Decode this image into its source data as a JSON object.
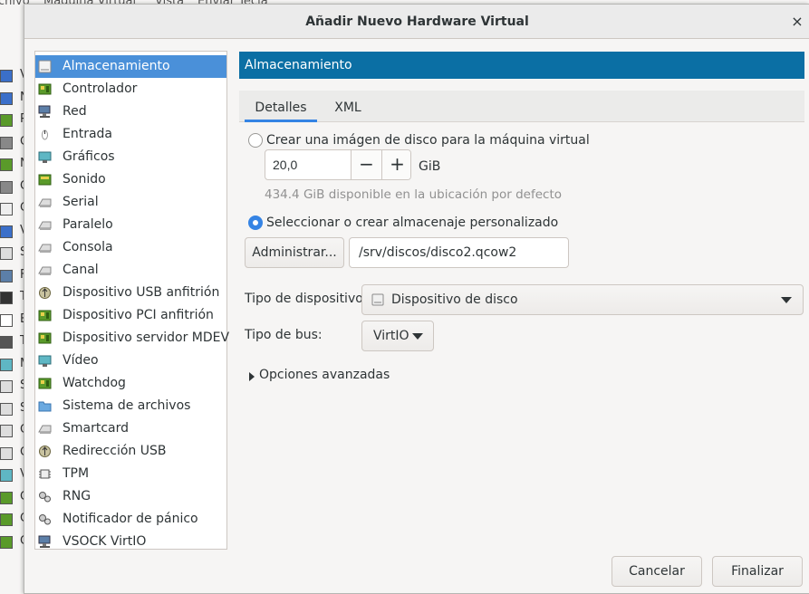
{
  "background": {
    "menu": [
      "chivo",
      "Máquina Virtual",
      "Vista",
      "Enviar Tecla"
    ],
    "side_letters": [
      "V",
      "N",
      "P",
      "C",
      "N",
      "C",
      "C",
      "V",
      "S",
      "F",
      "T",
      "E",
      "T",
      "M",
      "S",
      "S",
      "C",
      "C",
      "V",
      "C",
      "C",
      "C"
    ]
  },
  "dialog": {
    "title": "Añadir Nuevo Hardware Virtual",
    "close_glyph": "×"
  },
  "hardware_list": {
    "selected_index": 0,
    "items": [
      {
        "label": "Almacenamiento",
        "icon": "disk-icon"
      },
      {
        "label": "Controlador",
        "icon": "controller-icon"
      },
      {
        "label": "Red",
        "icon": "network-icon"
      },
      {
        "label": "Entrada",
        "icon": "mouse-icon"
      },
      {
        "label": "Gráficos",
        "icon": "monitor-icon"
      },
      {
        "label": "Sonido",
        "icon": "sound-icon"
      },
      {
        "label": "Serial",
        "icon": "serial-icon"
      },
      {
        "label": "Paralelo",
        "icon": "parallel-icon"
      },
      {
        "label": "Consola",
        "icon": "console-icon"
      },
      {
        "label": "Canal",
        "icon": "channel-icon"
      },
      {
        "label": "Dispositivo USB anfitrión",
        "icon": "usb-icon"
      },
      {
        "label": "Dispositivo PCI anfitrión",
        "icon": "pci-icon"
      },
      {
        "label": "Dispositivo servidor MDEV",
        "icon": "mdev-icon"
      },
      {
        "label": "Vídeo",
        "icon": "video-icon"
      },
      {
        "label": "Watchdog",
        "icon": "watchdog-icon"
      },
      {
        "label": "Sistema de archivos",
        "icon": "folder-icon"
      },
      {
        "label": "Smartcard",
        "icon": "smartcard-icon"
      },
      {
        "label": "Redirección USB",
        "icon": "usb-redirect-icon"
      },
      {
        "label": "TPM",
        "icon": "chip-icon"
      },
      {
        "label": "RNG",
        "icon": "gears-icon"
      },
      {
        "label": "Notificador de pánico",
        "icon": "panic-icon"
      },
      {
        "label": "VSOCK VirtIO",
        "icon": "vsock-icon"
      }
    ]
  },
  "panel": {
    "header": "Almacenamiento",
    "tabs": [
      {
        "label": "Detalles",
        "active": true
      },
      {
        "label": "XML",
        "active": false
      }
    ],
    "create_image": {
      "label": "Crear una imágen de disco para la máquina virtual",
      "checked": false,
      "size_value": "20,0",
      "minus": "−",
      "plus": "+",
      "unit": "GiB",
      "available": "434.4 GiB disponible en la ubicación por defecto"
    },
    "custom_storage": {
      "label": "Seleccionar o crear almacenaje personalizado",
      "checked": true,
      "manage_button": "Administrar...",
      "path": "/srv/discos/disco2.qcow2"
    },
    "device_type": {
      "label": "Tipo de dispositivo:",
      "value": "Dispositivo de disco",
      "icon": "disk-icon"
    },
    "bus_type": {
      "label": "Tipo de bus:",
      "value": "VirtIO"
    },
    "advanced": "Opciones avanzadas"
  },
  "footer": {
    "cancel": "Cancelar",
    "finish": "Finalizar"
  },
  "colors": {
    "selection": "#4a90d9",
    "header": "#0b6fa4",
    "accent": "#3584e4"
  }
}
